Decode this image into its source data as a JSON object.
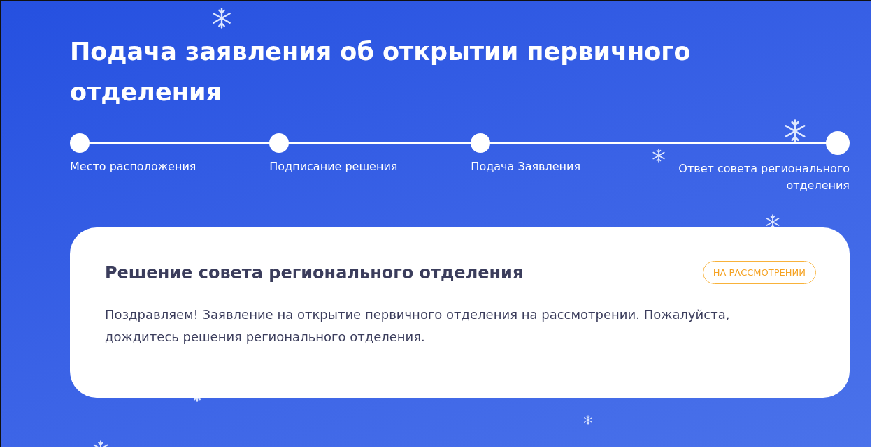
{
  "title": "Подача заявления об открытии первичного отделения",
  "steps": [
    {
      "label": "Место расположения",
      "current": false
    },
    {
      "label": "Подписание решения",
      "current": false
    },
    {
      "label": "Подача Заявления",
      "current": false
    },
    {
      "label": "Ответ совета регионального отделения",
      "current": true
    }
  ],
  "card": {
    "title": "Решение совета регионального отделения",
    "status": "НА РАССМОТРЕНИИ",
    "message": "Поздравляем! Заявление на открытие первичного отделения на рассмотрении. Пожалуйста, дождитесь решения регионального отделения."
  }
}
